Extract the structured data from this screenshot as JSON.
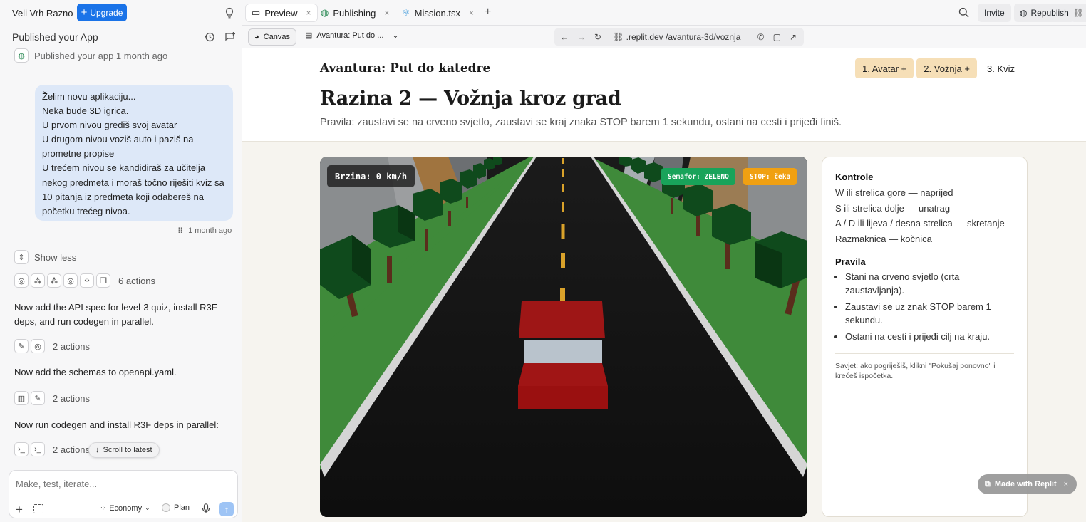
{
  "user": {
    "name": "Veli Vrh Razno",
    "upgrade_label": "Upgrade"
  },
  "left": {
    "header": "Published your App",
    "published_note": "Published your app 1 month ago",
    "message_lines": [
      "Želim novu aplikaciju...",
      "Neka bude 3D igrica.",
      "U prvom nivou grediš svoj avatar",
      "U drugom nivou voziš auto i paziš na",
      "prometne propise",
      "U trećem nivou se kandidiraš za učitelja",
      "nekog predmeta i moraš točno riješiti kviz sa",
      "10 pitanja iz predmeta koji odabereš na",
      "početku trećeg nivoa."
    ],
    "message_time": "1 month ago",
    "show_less": "Show less",
    "actions": [
      {
        "label": "6 actions"
      },
      {
        "label": "2 actions"
      },
      {
        "label": "2 actions"
      },
      {
        "label": "2 actions"
      }
    ],
    "msg_api": "Now add the API spec for level-3 quiz, install R3F deps, and run codegen in parallel.",
    "msg_schemas": "Now add the schemas to openapi.yaml.",
    "msg_codegen": "Now run codegen and install R3F deps in parallel:",
    "scroll_latest": "Scroll to latest",
    "composer_placeholder": "Make, test, iterate...",
    "mode": "Economy",
    "plan": "Plan"
  },
  "tabs": [
    {
      "label": "Preview",
      "icon": "monitor-icon"
    },
    {
      "label": "Publishing",
      "icon": "globe-icon"
    },
    {
      "label": "Mission.tsx",
      "icon": "react-icon"
    }
  ],
  "toolbar": {
    "invite": "Invite",
    "republish": "Republish"
  },
  "addr": {
    "canvas": "Canvas",
    "page": "Avantura: Put do ...",
    "url": ".replit.dev /avantura-3d/voznja"
  },
  "app": {
    "brand": "Avantura: Put do katedre",
    "steps": [
      "1. Avatar +",
      "2. Vožnja +",
      "3. Kviz"
    ],
    "level_title": "Razina 2 — Vožnja kroz grad",
    "rules_line": "Pravila: zaustavi se na crveno svjetlo, zaustavi se kraj znaka STOP barem 1 sekundu, ostani na cesti i prijeđi finiš.",
    "hud": {
      "speed": "Brzina: 0 km/h",
      "semafor": "Semafor: ZELENO",
      "stop": "STOP: čeka"
    },
    "colors": {
      "semafor": "#19a35a",
      "stop": "#f0a012",
      "step_done": "#f6dfb7"
    },
    "controls_title": "Kontrole",
    "controls": [
      "W ili strelica gore — naprijed",
      "S ili strelica dolje — unatrag",
      "A / D ili lijeva / desna strelica — skretanje",
      "Razmaknica — kočnica"
    ],
    "rules_title": "Pravila",
    "rules": [
      "Stani na crveno svjetlo (crta zaustavljanja).",
      "Zaustavi se uz znak STOP barem 1 sekundu.",
      "Ostani na cesti i prijeđi cilj na kraju."
    ],
    "tip": "Savjet: ako pogriješiš, klikni \"Pokušaj ponovno\" i krećeš ispočetka.",
    "made_with": "Made with Replit"
  }
}
